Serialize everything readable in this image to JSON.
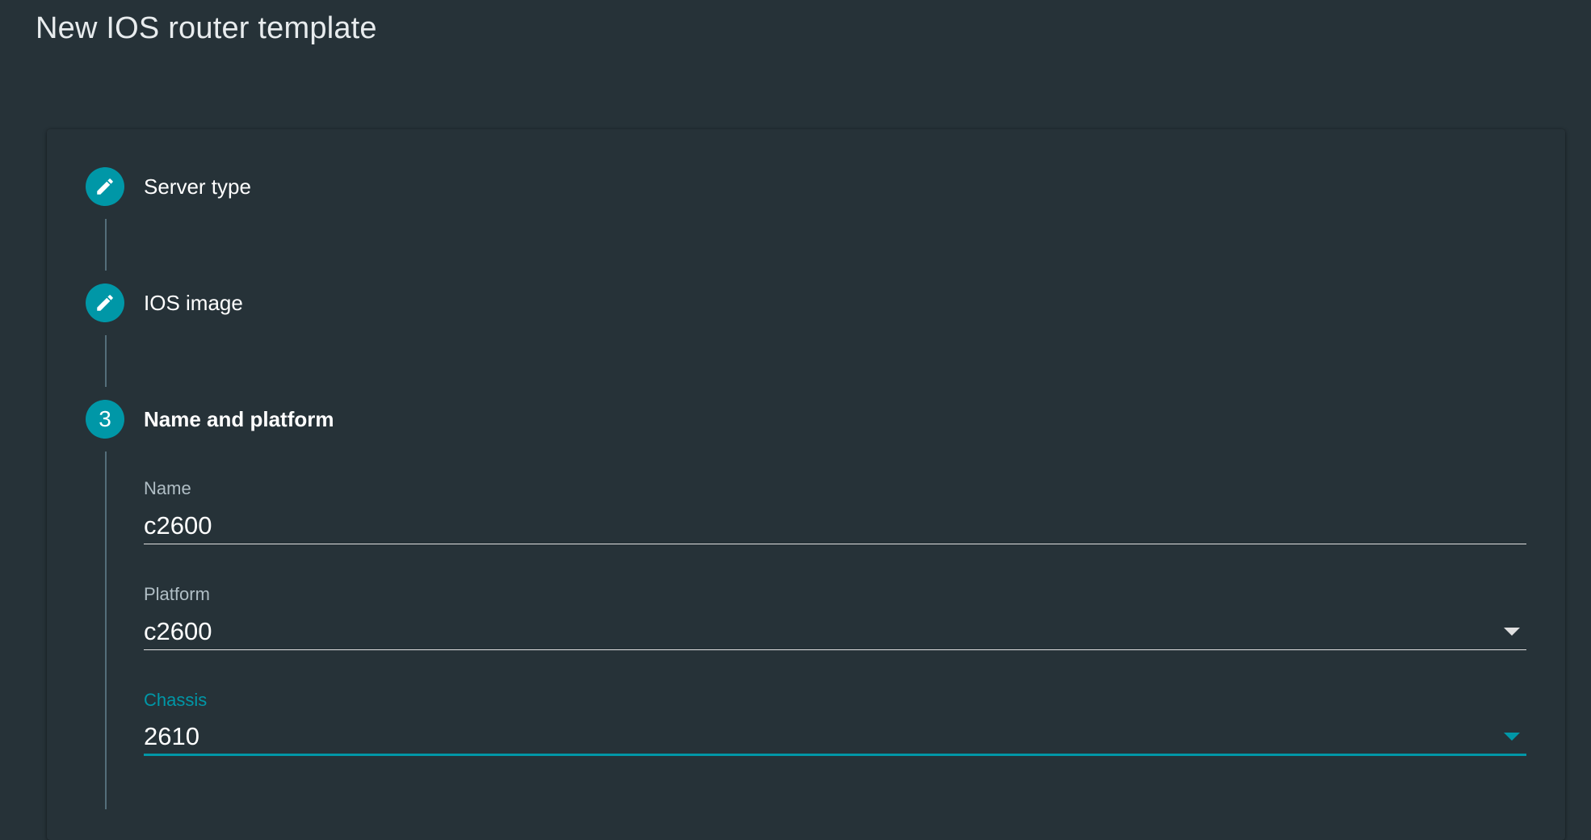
{
  "page": {
    "title": "New IOS router template"
  },
  "stepper": {
    "steps": [
      {
        "label": "Server type",
        "icon": "pencil-icon",
        "state": "edit"
      },
      {
        "label": "IOS image",
        "icon": "pencil-icon",
        "state": "edit"
      },
      {
        "label": "Name and platform",
        "number": "3",
        "state": "active"
      }
    ]
  },
  "form": {
    "name": {
      "label": "Name",
      "value": "c2600"
    },
    "platform": {
      "label": "Platform",
      "value": "c2600"
    },
    "chassis": {
      "label": "Chassis",
      "value": "2610"
    }
  },
  "colors": {
    "background": "#263238",
    "accent": "#0097a7",
    "text": "#ffffff",
    "label": "#b0bec5"
  }
}
